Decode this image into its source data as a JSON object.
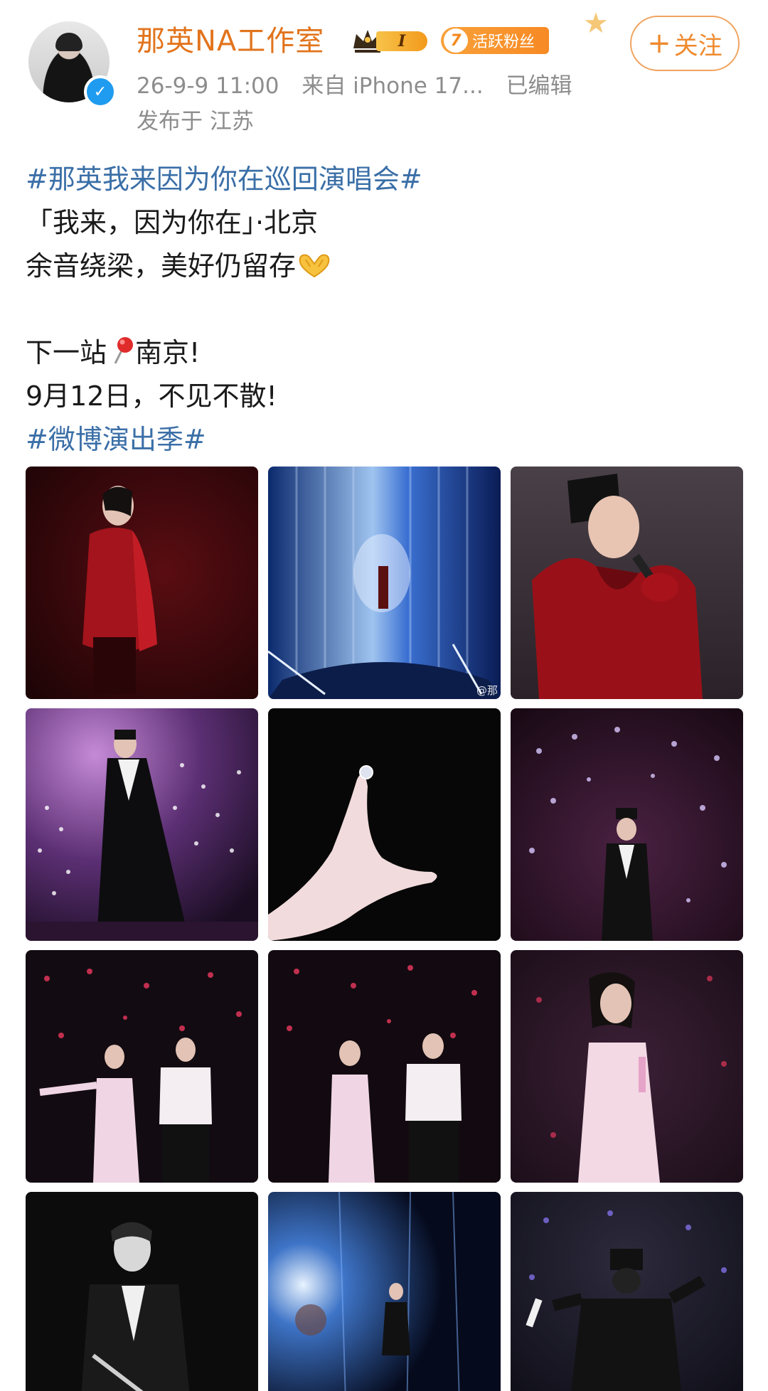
{
  "header": {
    "name": "那英NA工作室",
    "vip_level": "I",
    "fan_badge_level": "7",
    "fan_badge_label": "活跃粉丝",
    "follow_label": "关注",
    "date": "26-9-9 11:00",
    "source": "来自 iPhone 17...",
    "edited": "已编辑",
    "location": "发布于 江苏"
  },
  "post": {
    "topic_1": "#那英我来因为你在巡回演唱会#",
    "line_2": "「我来，因为你在」·北京",
    "line_3": "余音绕梁，美好仍留存",
    "line_5_before": "下一站",
    "line_5_after": "南京!",
    "line_6": "9月12日，不见不散!",
    "topic_2": "#微博演出季#"
  },
  "photos": {
    "watermark": "@那",
    "count": 12
  },
  "colors": {
    "name": "#e2741d",
    "topic": "#3b6fa7",
    "meta": "#8d8d8d",
    "follow": "#ef8a2f",
    "fan_badge": "#f7902a",
    "verify": "#1f9cf0"
  },
  "icons": [
    "verified-icon",
    "crown-icon",
    "star-icon",
    "plus-icon",
    "pin-icon",
    "heart-hands-icon"
  ]
}
